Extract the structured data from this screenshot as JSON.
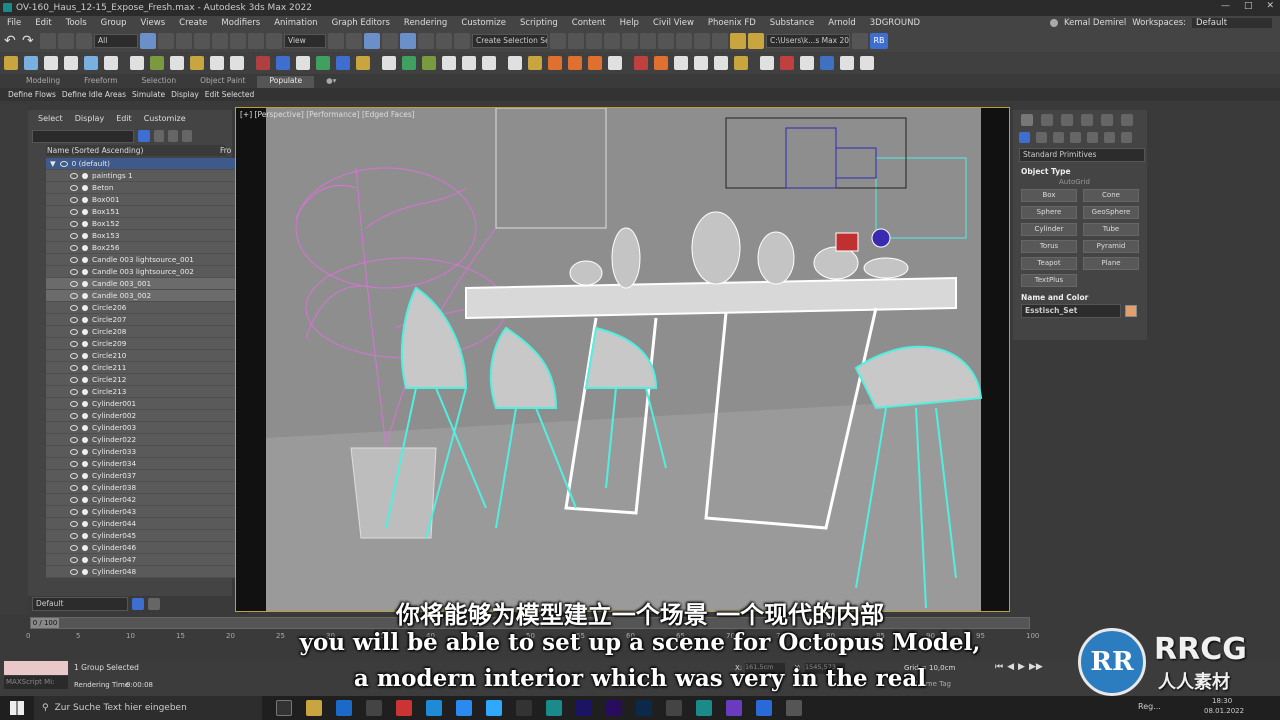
{
  "window": {
    "title": "OV-160_Haus_12-15_Expose_Fresh.max - Autodesk 3ds Max 2022"
  },
  "menubar": {
    "items": [
      "File",
      "Edit",
      "Tools",
      "Group",
      "Views",
      "Create",
      "Modifiers",
      "Animation",
      "Graph Editors",
      "Rendering",
      "Customize",
      "Scripting",
      "Content",
      "Help",
      "Civil View",
      "Phoenix FD",
      "Substance",
      "Arnold",
      "3DGROUND"
    ],
    "user": "Kemal Demirel",
    "workspaces_label": "Workspaces:",
    "workspace_value": "Default"
  },
  "toolbar": {
    "filter_value": "All",
    "view_value": "View",
    "selection_set_placeholder": "Create Selection Se",
    "path_value": "C:\\Users\\k...s Max 2022",
    "badge": "RB"
  },
  "ribbon": {
    "tabs": [
      "Modeling",
      "Freeform",
      "Selection",
      "Object Paint",
      "Populate"
    ],
    "active_tab": "Populate",
    "buttons": [
      "Define Flows",
      "Define Idle Areas",
      "Simulate",
      "Display",
      "Edit Selected"
    ]
  },
  "scene_explorer": {
    "menu": [
      "Select",
      "Display",
      "Edit",
      "Customize"
    ],
    "column_header": "Name (Sorted Ascending)",
    "column_header2": "Fro",
    "layer_root": "0 (default)",
    "rows": [
      "paintings 1",
      "Beton",
      "Box001",
      "Box151",
      "Box152",
      "Box153",
      "Box256",
      "Candle 003 lightsource_001",
      "Candle 003 lightsource_002",
      "Candle 003_001",
      "Candle 003_002",
      "Circle206",
      "Circle207",
      "Circle208",
      "Circle209",
      "Circle210",
      "Circle211",
      "Circle212",
      "Circle213",
      "Cylinder001",
      "Cylinder002",
      "Cylinder003",
      "Cylinder022",
      "Cylinder033",
      "Cylinder034",
      "Cylinder037",
      "Cylinder038",
      "Cylinder042",
      "Cylinder043",
      "Cylinder044",
      "Cylinder045",
      "Cylinder046",
      "Cylinder047",
      "Cylinder048"
    ],
    "selected_rows": [
      "Candle 003_001",
      "Candle 003_002"
    ],
    "layer_dropdown": "Default"
  },
  "viewport": {
    "label": "[+] [Perspective] [Performance] [Edged Faces]"
  },
  "command_panel": {
    "category": "Standard Primitives",
    "object_type_title": "Object Type",
    "autogrid_label": "AutoGrid",
    "buttons": [
      "Box",
      "Cone",
      "Sphere",
      "GeoSphere",
      "Cylinder",
      "Tube",
      "Torus",
      "Pyramid",
      "Teapot",
      "Plane",
      "TextPlus"
    ],
    "name_color_title": "Name and Color",
    "object_name": "Esstisch_Set",
    "object_color": "#e0a070"
  },
  "timeline": {
    "frame_readout": "0 / 100",
    "ticks": [
      "0",
      "5",
      "10",
      "15",
      "20",
      "25",
      "30",
      "35",
      "40",
      "45",
      "50",
      "55",
      "60",
      "65",
      "70",
      "75",
      "80",
      "85",
      "90",
      "95",
      "100"
    ]
  },
  "status": {
    "maxscript_label": "MAXScript Mi:",
    "selection_status": "1 Group Selected",
    "rendering_time_label": "Rendering Time",
    "rendering_time_value": "0:00:08",
    "x_label": "X:",
    "y_label": "Y:",
    "x_value": "161,5cm",
    "y_value": "1545,573",
    "grid_label": "Grid = 10,0cm",
    "time_tag": "Add Time Tag"
  },
  "taskbar": {
    "search_placeholder": "Zur Suche Text hier eingeben",
    "tray_text": "Reg...",
    "clock_time": "18:30",
    "clock_date": "08.01.2022"
  },
  "subtitles": {
    "zh": "你将能够为模型建立一个场景 一个现代的内部",
    "en_line1": "you will be able to set up a scene for Octopus Model,",
    "en_line2": "a modern interior which was very in the real"
  },
  "watermark": {
    "brand": "RRCG",
    "brand_sub": "人人素材",
    "logo_initials": "RR"
  },
  "colors": {
    "accent_blue": "#3e6fd0",
    "selection_yellow": "#b8a040",
    "wire_cyan": "#4ff0e0",
    "wire_pink": "#e070e0"
  }
}
